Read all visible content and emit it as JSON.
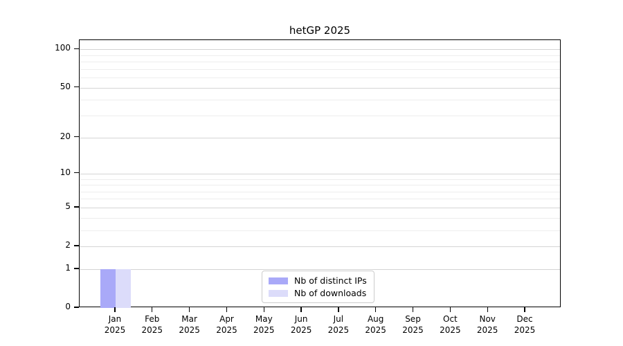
{
  "title": "hetGP 2025",
  "legend": {
    "items": [
      {
        "label": "Nb of distinct IPs",
        "color": "#a9a9f8"
      },
      {
        "label": "Nb of downloads",
        "color": "#dcdcfa"
      }
    ]
  },
  "colors": {
    "distinct_ips_bar": "#a9a9f8",
    "downloads_bar": "#dcdcfa",
    "major_grid": "#d4d4d4",
    "minor_grid": "#ededed",
    "axis": "#000000"
  },
  "chart_data": {
    "type": "bar",
    "title": "hetGP 2025",
    "categories": [
      "Jan 2025",
      "Feb 2025",
      "Mar 2025",
      "Apr 2025",
      "May 2025",
      "Jun 2025",
      "Jul 2025",
      "Aug 2025",
      "Sep 2025",
      "Oct 2025",
      "Nov 2025",
      "Dec 2025"
    ],
    "series": [
      {
        "name": "Nb of distinct IPs",
        "color": "#a9a9f8",
        "values": [
          1,
          0,
          0,
          0,
          0,
          0,
          0,
          0,
          0,
          0,
          0,
          0
        ]
      },
      {
        "name": "Nb of downloads",
        "color": "#dcdcfa",
        "values": [
          1,
          0,
          0,
          0,
          0,
          0,
          0,
          0,
          0,
          0,
          0,
          0
        ]
      }
    ],
    "xlabel": "",
    "ylabel": "",
    "yscale": "log1p",
    "ylim": [
      0,
      118
    ],
    "yticks": [
      0,
      1,
      2,
      5,
      10,
      20,
      50,
      100
    ],
    "yminorticks": [
      3,
      4,
      6,
      7,
      8,
      9,
      30,
      40,
      60,
      70,
      80,
      90
    ],
    "grid": "horizontal",
    "legend_position": "bottom-center"
  }
}
